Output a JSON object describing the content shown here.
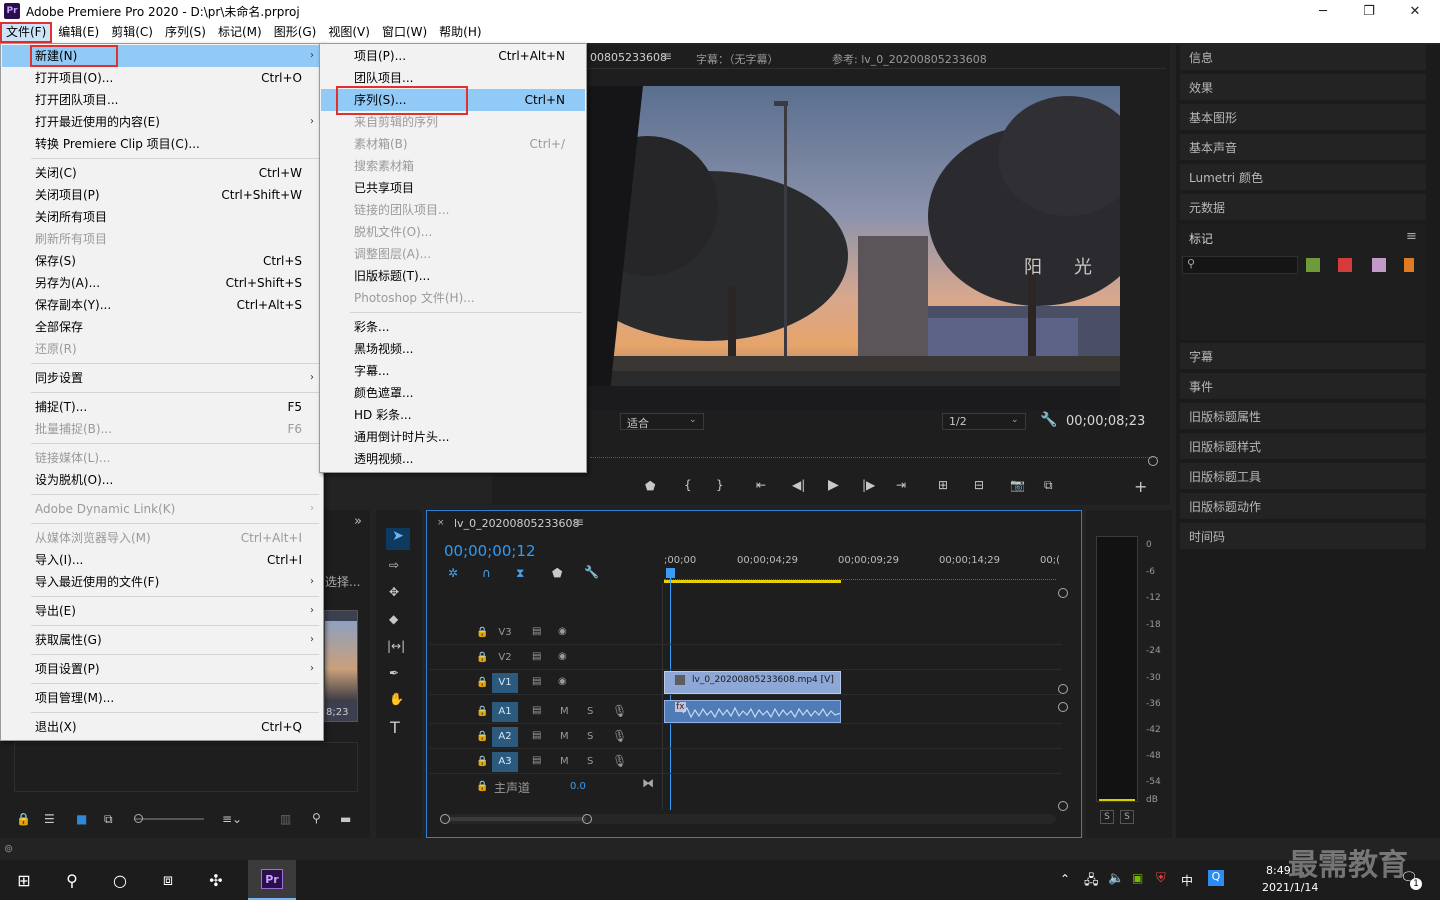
{
  "window": {
    "title": "Adobe Premiere Pro 2020 - D:\\pr\\未命名.prproj",
    "app_icon": "Pr",
    "minimize": "─",
    "maximize": "❐",
    "close": "✕"
  },
  "menubar": [
    "文件(F)",
    "编辑(E)",
    "剪辑(C)",
    "序列(S)",
    "标记(M)",
    "图形(G)",
    "视图(V)",
    "窗口(W)",
    "帮助(H)"
  ],
  "file_menu": [
    {
      "label": "新建(N)",
      "shortcut": "",
      "submenu": true,
      "highlight": true
    },
    {
      "label": "打开项目(O)...",
      "shortcut": "Ctrl+O"
    },
    {
      "label": "打开团队项目..."
    },
    {
      "label": "打开最近使用的内容(E)",
      "submenu": true
    },
    {
      "label": "转换 Premiere Clip 项目(C)..."
    },
    {
      "sep": true
    },
    {
      "label": "关闭(C)",
      "shortcut": "Ctrl+W"
    },
    {
      "label": "关闭项目(P)",
      "shortcut": "Ctrl+Shift+W"
    },
    {
      "label": "关闭所有项目"
    },
    {
      "label": "刷新所有项目",
      "disabled": true
    },
    {
      "label": "保存(S)",
      "shortcut": "Ctrl+S"
    },
    {
      "label": "另存为(A)...",
      "shortcut": "Ctrl+Shift+S"
    },
    {
      "label": "保存副本(Y)...",
      "shortcut": "Ctrl+Alt+S"
    },
    {
      "label": "全部保存"
    },
    {
      "label": "还原(R)",
      "disabled": true
    },
    {
      "sep": true
    },
    {
      "label": "同步设置",
      "submenu": true
    },
    {
      "sep": true
    },
    {
      "label": "捕捉(T)...",
      "shortcut": "F5"
    },
    {
      "label": "批量捕捉(B)...",
      "shortcut": "F6",
      "disabled": true
    },
    {
      "sep": true
    },
    {
      "label": "链接媒体(L)...",
      "disabled": true
    },
    {
      "label": "设为脱机(O)..."
    },
    {
      "sep": true
    },
    {
      "label": "Adobe Dynamic Link(K)",
      "submenu": true,
      "disabled": true
    },
    {
      "sep": true
    },
    {
      "label": "从媒体浏览器导入(M)",
      "shortcut": "Ctrl+Alt+I",
      "disabled": true
    },
    {
      "label": "导入(I)...",
      "shortcut": "Ctrl+I"
    },
    {
      "label": "导入最近使用的文件(F)",
      "submenu": true
    },
    {
      "sep": true
    },
    {
      "label": "导出(E)",
      "submenu": true
    },
    {
      "sep": true
    },
    {
      "label": "获取属性(G)",
      "submenu": true
    },
    {
      "sep": true
    },
    {
      "label": "项目设置(P)",
      "submenu": true
    },
    {
      "sep": true
    },
    {
      "label": "项目管理(M)..."
    },
    {
      "sep": true
    },
    {
      "label": "退出(X)",
      "shortcut": "Ctrl+Q"
    }
  ],
  "new_submenu": [
    {
      "label": "项目(P)...",
      "shortcut": "Ctrl+Alt+N"
    },
    {
      "label": "团队项目..."
    },
    {
      "label": "序列(S)...",
      "shortcut": "Ctrl+N",
      "highlight": true
    },
    {
      "label": "来自剪辑的序列",
      "disabled": true
    },
    {
      "label": "素材箱(B)",
      "shortcut": "Ctrl+/",
      "disabled": true
    },
    {
      "label": "搜索素材箱",
      "disabled": true
    },
    {
      "label": "已共享项目"
    },
    {
      "label": "链接的团队项目...",
      "disabled": true
    },
    {
      "label": "脱机文件(O)...",
      "disabled": true
    },
    {
      "label": "调整图层(A)...",
      "disabled": true
    },
    {
      "label": "旧版标题(T)..."
    },
    {
      "label": "Photoshop 文件(H)...",
      "disabled": true
    },
    {
      "sep": true
    },
    {
      "label": "彩条..."
    },
    {
      "label": "黑场视频..."
    },
    {
      "label": "字幕..."
    },
    {
      "label": "颜色遮罩..."
    },
    {
      "label": "HD 彩条..."
    },
    {
      "label": "通用倒计时片头..."
    },
    {
      "label": "透明视频..."
    }
  ],
  "program_monitor": {
    "tab_partial": "00805233608",
    "caption_label": "字幕：（无字幕）",
    "reference_label": "参考: lv_0_20200805233608",
    "fit_label": "适合",
    "quality": "1/2",
    "timecode": "00;00;08;23",
    "signage_chars": [
      "阳",
      "光"
    ]
  },
  "right_panel": {
    "items_top": [
      "信息",
      "效果",
      "基本图形",
      "基本声音",
      "Lumetri 颜色",
      "元数据"
    ],
    "markers_title": "标记",
    "marker_colors": [
      "#6f9a3a",
      "#d63b3b",
      "#c39ac7",
      "#e07a20"
    ],
    "items_bottom": [
      "字幕",
      "事件",
      "旧版标题属性",
      "旧版标题样式",
      "旧版标题工具",
      "旧版标题动作",
      "时间码"
    ]
  },
  "project_panel": {
    "select_hint": "选择...",
    "thumb_time": "8;23"
  },
  "timeline": {
    "sequence_name": "lv_0_20200805233608",
    "timecode": "00;00;00;12",
    "ruler": [
      ";00;00",
      "00;00;04;29",
      "00;00;09;29",
      "00;00;14;29",
      "00;("
    ],
    "video_tracks": [
      "V3",
      "V2",
      "V1"
    ],
    "audio_tracks": [
      "A1",
      "A2",
      "A3"
    ],
    "master_label": "主声道",
    "master_value": "0.0",
    "video_clip": "lv_0_20200805233608.mp4 [V]",
    "audio_clip_fx": "fx",
    "m_label": "M",
    "s_label": "S"
  },
  "meter": {
    "scale": [
      "0",
      "-6",
      "-12",
      "-18",
      "-24",
      "-30",
      "-36",
      "-42",
      "-48",
      "-54",
      "dB"
    ],
    "solo_buttons": [
      "S",
      "S"
    ]
  },
  "taskbar": {
    "time": "8:49",
    "date": "2021/1/14",
    "ime": "中",
    "notification_count": "1",
    "pr_label": "Pr"
  },
  "watermark": "最需教育"
}
